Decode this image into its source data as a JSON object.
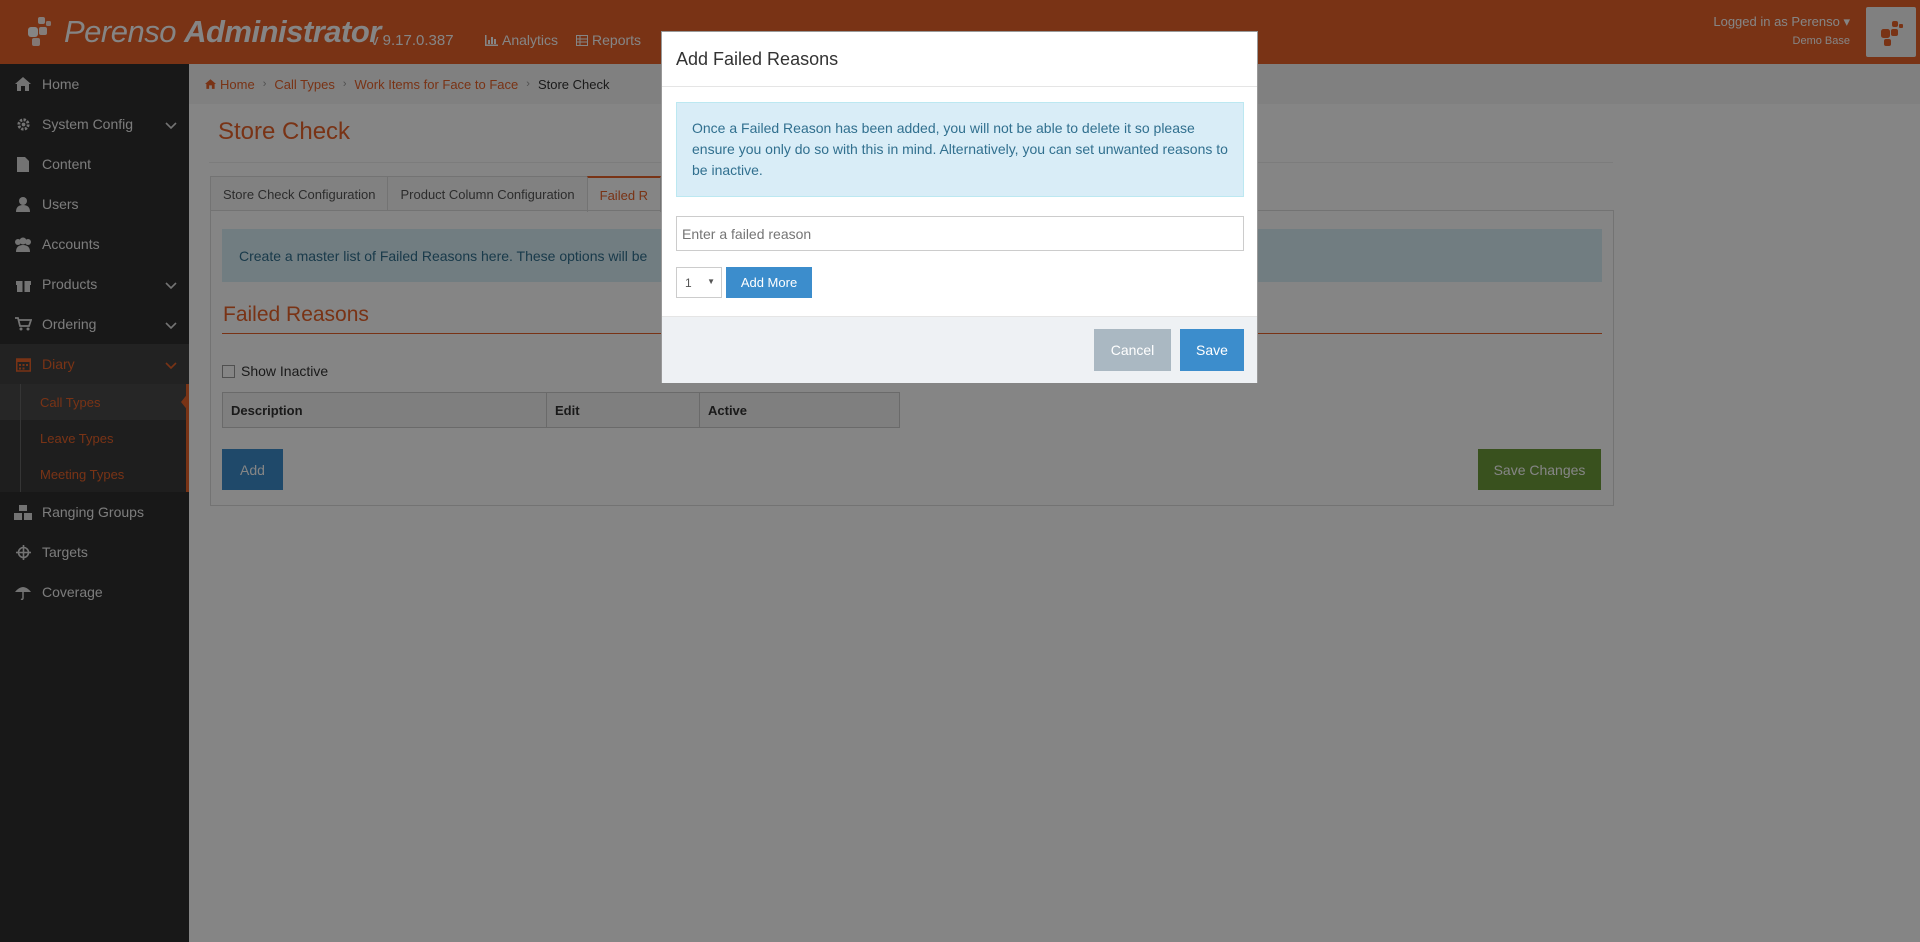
{
  "header": {
    "logo_light": "Perenso",
    "logo_bold": "Administrator",
    "version": "v 9.17.0.387",
    "nav": [
      {
        "label": "Analytics",
        "icon": "bar-chart-icon"
      },
      {
        "label": "Reports",
        "icon": "table-icon"
      }
    ],
    "user": {
      "logged_in_as": "Logged in as Perenso",
      "database": "Demo Base"
    }
  },
  "sidebar": {
    "items": [
      {
        "label": "Home",
        "icon": "home-icon"
      },
      {
        "label": "System Config",
        "icon": "gear-icon"
      },
      {
        "label": "Content",
        "icon": "file-icon"
      },
      {
        "label": "Users",
        "icon": "user-icon"
      },
      {
        "label": "Accounts",
        "icon": "users-icon"
      },
      {
        "label": "Products",
        "icon": "gift-icon"
      },
      {
        "label": "Ordering",
        "icon": "cart-icon"
      },
      {
        "label": "Diary",
        "icon": "calendar-icon"
      }
    ],
    "diary_sub": [
      {
        "label": "Call Types"
      },
      {
        "label": "Leave Types"
      },
      {
        "label": "Meeting Types"
      }
    ],
    "items_after": [
      {
        "label": "Ranging Groups",
        "icon": "cubes-icon"
      },
      {
        "label": "Targets",
        "icon": "crosshairs-icon"
      },
      {
        "label": "Coverage",
        "icon": "umbrella-icon"
      }
    ]
  },
  "breadcrumb": {
    "home": "Home",
    "call_types": "Call Types",
    "work_items": "Work Items for Face to Face",
    "current": "Store Check"
  },
  "page": {
    "title": "Store Check",
    "tabs": [
      "Store Check Configuration",
      "Product Column Configuration",
      "Failed R"
    ],
    "info": "Create a master list of Failed Reasons here. These options will be",
    "section_title": "Failed Reasons",
    "show_inactive": "Show Inactive",
    "table_headers": [
      "Description",
      "Edit",
      "Active"
    ],
    "add_label": "Add",
    "save_changes_label": "Save Changes"
  },
  "modal": {
    "title": "Add Failed Reasons",
    "alert": "Once a Failed Reason has been added, you will not be able to delete it so please ensure you only do so with this in mind. Alternatively, you can set unwanted reasons to be inactive.",
    "input_placeholder": "Enter a failed reason",
    "quantity_value": "1",
    "add_more_label": "Add More",
    "cancel_label": "Cancel",
    "save_label": "Save"
  },
  "colors": {
    "brand": "#e8622a",
    "sidebar_bg": "#2e2e2e",
    "primary_button": "#3c8dcc",
    "success_button": "#6d9b3b",
    "info_bg": "#d9edf7"
  }
}
